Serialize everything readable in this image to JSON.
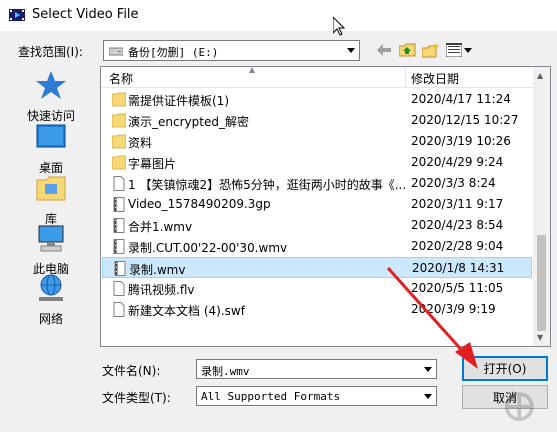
{
  "window": {
    "title": "Select Video File"
  },
  "lookin": {
    "label": "查找范围(I):",
    "value": "备份[勿删] (E:)"
  },
  "places": [
    {
      "label": "快速访问",
      "icon": "star-icon"
    },
    {
      "label": "桌面",
      "icon": "desktop-icon"
    },
    {
      "label": "库",
      "icon": "library-icon"
    },
    {
      "label": "此电脑",
      "icon": "computer-icon"
    },
    {
      "label": "网络",
      "icon": "network-icon"
    }
  ],
  "columns": {
    "name": "名称",
    "modified": "修改日期"
  },
  "files": [
    {
      "name": "需提供证件模板(1)",
      "date": "2020/4/17 11:24",
      "type": "folder"
    },
    {
      "name": "演示_encrypted_解密",
      "date": "2020/12/15 10:27",
      "type": "folder"
    },
    {
      "name": "资料",
      "date": "2020/3/19 10:26",
      "type": "folder"
    },
    {
      "name": "字幕图片",
      "date": "2020/4/29 9:24",
      "type": "folder"
    },
    {
      "name": "1 【笑镇惊魂2】恐怖5分钟，逛街两小时的故事《...",
      "date": "2020/3/3 8:24",
      "type": "file"
    },
    {
      "name": "Video_1578490209.3gp",
      "date": "2020/3/11 9:17",
      "type": "video"
    },
    {
      "name": "合并1.wmv",
      "date": "2020/4/23 8:54",
      "type": "video"
    },
    {
      "name": "录制.CUT.00'22-00'30.wmv",
      "date": "2020/2/28 9:04",
      "type": "video"
    },
    {
      "name": "录制.wmv",
      "date": "2020/1/8 14:31",
      "type": "video",
      "selected": true
    },
    {
      "name": "腾讯视频.flv",
      "date": "2020/5/5 11:05",
      "type": "file"
    },
    {
      "name": "新建文本文档 (4).swf",
      "date": "2020/3/9 9:19",
      "type": "file"
    }
  ],
  "filename": {
    "label": "文件名(N):",
    "value": "录制.wmv"
  },
  "filetype": {
    "label": "文件类型(T):",
    "value": "All Supported Formats"
  },
  "buttons": {
    "open": "打开(O)",
    "cancel": "取消"
  },
  "colors": {
    "selection": "#cce8ff",
    "folder": "#f8d775",
    "accent": "#0078d7",
    "arrow": "#e02020"
  }
}
